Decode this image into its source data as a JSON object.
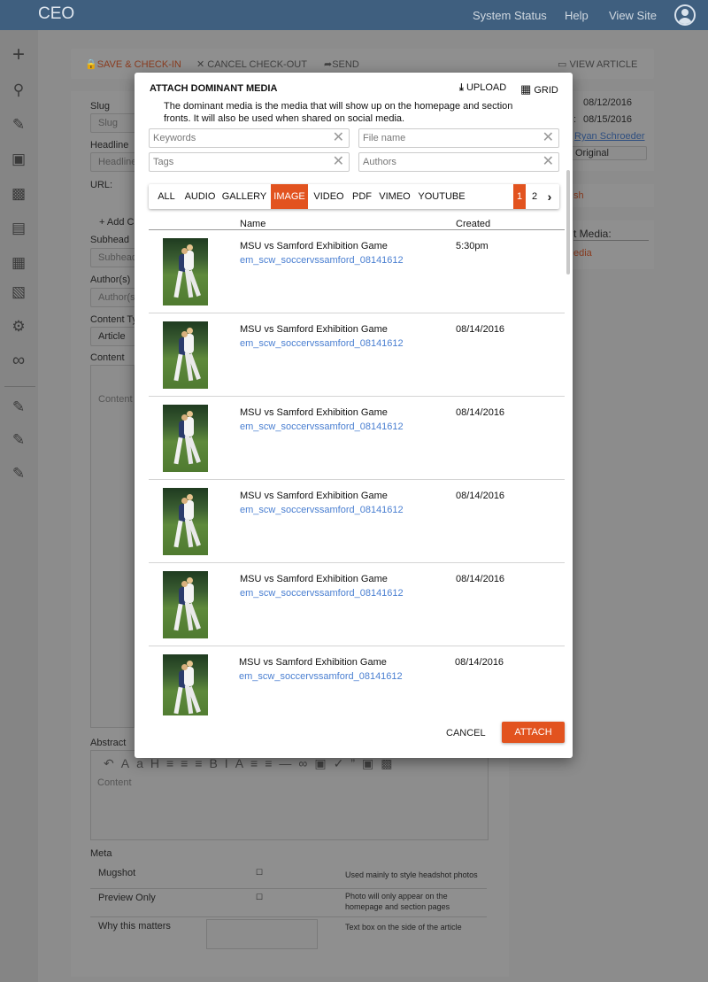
{
  "app": {
    "logo": "CEO",
    "nav": [
      "System Status",
      "Help",
      "View Site"
    ]
  },
  "toolbar": {
    "save_checkin": "SAVE & CHECK-IN",
    "cancel_checkout": "CANCEL CHECK-OUT",
    "send": "SEND",
    "view_article": "VIEW ARTICLE"
  },
  "article_form": {
    "slug_label": "Slug",
    "slug_placeholder": "Slug",
    "headline_label": "Headline",
    "headline_placeholder": "Headline",
    "url_label": "URL:",
    "add_label": "Add C",
    "subhead_label": "Subhead",
    "subhead_placeholder": "Subhead",
    "authors_label": "Author(s)",
    "authors_placeholder": "Author(s",
    "content_type_label": "Content Ty",
    "content_type_value": "Article",
    "content_label": "Content",
    "content_placeholder": "Content",
    "abstract_label": "Abstract",
    "abstract_placeholder": "Content",
    "meta_label": "Meta",
    "meta_rows": [
      {
        "label": "Mugshot",
        "note": "Used mainly to style headshot photos"
      },
      {
        "label": "Preview Only",
        "note": "Photo will only appear on the homepage and section pages"
      },
      {
        "label": "Why this matters",
        "note": "Text box on the side of the article"
      }
    ]
  },
  "side_info": {
    "date1": "08/12/2016",
    "date2": "08/15/2016",
    "author": "Ryan Schroeder",
    "original": "Original",
    "publish_partial": "sh",
    "media_heading": "t Media:",
    "media_link": "edia"
  },
  "modal": {
    "title": "ATTACH DOMINANT MEDIA",
    "upload": "UPLOAD",
    "grid": "GRID",
    "description": "The dominant media is the media that will show up on the homepage and section fronts. It will also be used when shared on social media.",
    "filters": {
      "keywords": "Keywords",
      "file_name": "File name",
      "tags": "Tags",
      "authors": "Authors"
    },
    "tabs": [
      "ALL",
      "AUDIO",
      "GALLERY",
      "IMAGE",
      "VIDEO",
      "PDF",
      "VIMEO",
      "YOUTUBE"
    ],
    "active_tab": "IMAGE",
    "pages": [
      "1",
      "2"
    ],
    "current_page": "1",
    "columns": {
      "name": "Name",
      "created": "Created"
    },
    "rows": [
      {
        "name": "MSU vs Samford Exhibition Game",
        "file": "em_scw_soccervssamford_08141612",
        "created": "5:30pm"
      },
      {
        "name": "MSU vs Samford Exhibition Game",
        "file": "em_scw_soccervssamford_08141612",
        "created": "08/14/2016"
      },
      {
        "name": "MSU vs Samford Exhibition Game",
        "file": "em_scw_soccervssamford_08141612",
        "created": "08/14/2016"
      },
      {
        "name": "MSU vs Samford Exhibition Game",
        "file": "em_scw_soccervssamford_08141612",
        "created": "08/14/2016"
      },
      {
        "name": "MSU vs Samford Exhibition Game",
        "file": "em_scw_soccervssamford_08141612",
        "created": "08/14/2016"
      },
      {
        "name": "MSU vs Samford Exhibition Game",
        "file": "em_scw_soccervssamford_08141612",
        "created": "08/14/2016"
      }
    ],
    "cancel": "CANCEL",
    "attach": "ATTACH"
  },
  "colors": {
    "accent": "#e2531f",
    "topbar": "#3f5f7f",
    "link": "#4a7fd1"
  }
}
